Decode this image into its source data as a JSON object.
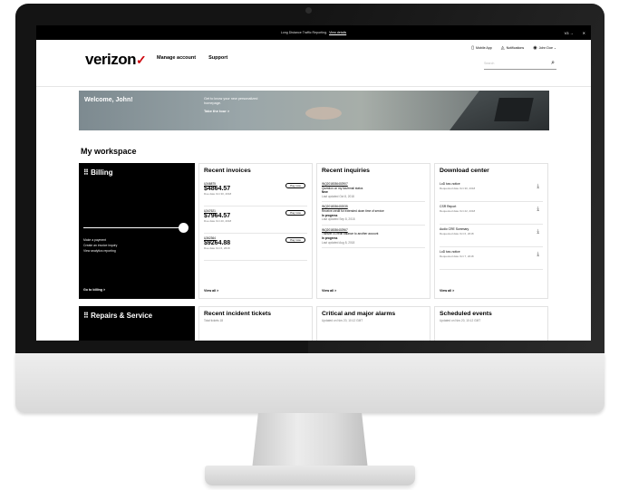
{
  "topbar": {
    "message": "Long Distance Traffic Reporting.",
    "link": "View details",
    "right_label": "V3 →",
    "close": "✕"
  },
  "header": {
    "logo": "verizon",
    "nav": [
      "Manage account",
      "Support"
    ],
    "utils": [
      "Mobile App",
      "Notifications",
      "John Doe"
    ],
    "search_placeholder": "Search"
  },
  "hero": {
    "welcome": "Welcome, John!",
    "subtitle": "Get to know your new personalized homepage.",
    "tour": "Take the tour >"
  },
  "workspace_title": "My workspace",
  "billing": {
    "title": "Billing",
    "links": [
      "Make a payment",
      "Create an invoice inquiry",
      "View analytics reporting"
    ],
    "go": "Go to billing >"
  },
  "invoices": {
    "title": "Recent invoices",
    "items": [
      {
        "id": "U346875",
        "amount": "$4864.57",
        "due": "Due date Oct 30, 2018",
        "pay": "Pay now"
      },
      {
        "id": "U347621",
        "amount": "$7964.57",
        "due": "Due date Oct 20, 2018",
        "pay": "Pay now"
      },
      {
        "id": "U362364",
        "amount": "$9264.88",
        "due": "Due date Oct 6, 2018",
        "pay": "Pay now"
      }
    ],
    "view_all": "View all >"
  },
  "inquiries": {
    "title": "Recent inquiries",
    "items": [
      {
        "id": "INQ2018036402907",
        "text": "Question on my fax/email status",
        "status": "New",
        "updated": "Last updated Oct 8, 2018"
      },
      {
        "id": "INQ2018036402035",
        "text": "Receive credit for extended down time of service",
        "status": "In progress",
        "updated": "Last updated Sep 8, 2018"
      },
      {
        "id": "INQ2018036402967",
        "text": "Transfer a credit balance to another account",
        "status": "In progress",
        "updated": "Last updated Aug 8, 2018"
      }
    ],
    "view_all": "View all >"
  },
  "downloads": {
    "title": "Download center",
    "items": [
      {
        "name": "LoD two-notice",
        "sub": "Requested date Oct 30, 2018"
      },
      {
        "name": "CSR Report",
        "sub": "Requested date Oct 22, 2018"
      },
      {
        "name": "Audio CRE Summary",
        "sub": "Requested date Oct 6, 2018"
      },
      {
        "name": "LoD two-notice",
        "sub": "Requested date Oct 7, 2018"
      }
    ],
    "view_all": "View all >"
  },
  "row2": {
    "repairs": "Repairs & Service",
    "incidents": {
      "title": "Recent incident tickets",
      "sub": "Total tickets 18"
    },
    "alarms": {
      "title": "Critical and major alarms",
      "sub": "Updated on Nov 20, 10:12 GMT"
    },
    "events": {
      "title": "Scheduled events",
      "sub": "Updated on Nov 20, 10:12 GMT"
    }
  }
}
